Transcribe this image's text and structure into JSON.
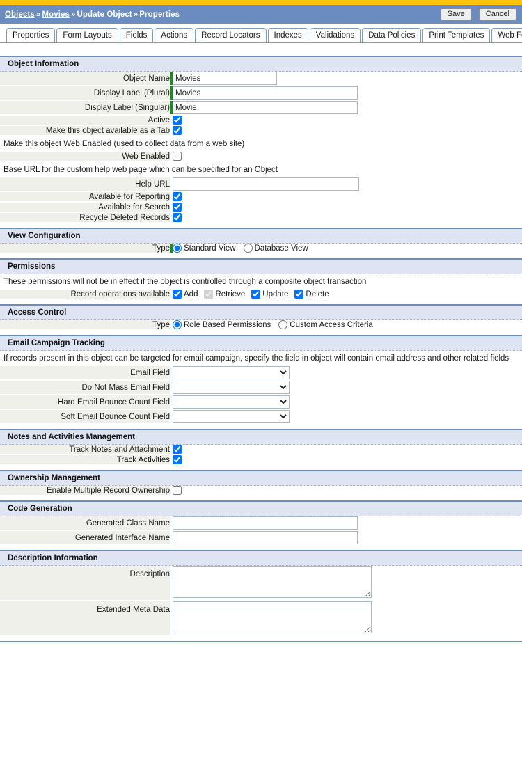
{
  "header": {
    "breadcrumb": [
      {
        "label": "Objects",
        "link": true
      },
      {
        "label": "Movies",
        "link": true
      },
      {
        "label": "Update Object",
        "link": false
      },
      {
        "label": "Properties",
        "link": false
      }
    ],
    "separator": "»",
    "save_label": "Save",
    "cancel_label": "Cancel",
    "accent_top_color": "#ffc20e",
    "bar_color": "#6b8cbe"
  },
  "tabs": [
    {
      "label": "Properties",
      "active": true
    },
    {
      "label": "Form Layouts",
      "active": false
    },
    {
      "label": "Fields",
      "active": false
    },
    {
      "label": "Actions",
      "active": false
    },
    {
      "label": "Record Locators",
      "active": false
    },
    {
      "label": "Indexes",
      "active": false
    },
    {
      "label": "Validations",
      "active": false
    },
    {
      "label": "Data Policies",
      "active": false
    },
    {
      "label": "Print Templates",
      "active": false
    },
    {
      "label": "Web Forms",
      "active": false
    }
  ],
  "sections": {
    "object_information": {
      "title": "Object Information",
      "object_name": {
        "label": "Object Name",
        "value": "Movies",
        "required": true
      },
      "display_label_plural": {
        "label": "Display Label (Plural)",
        "value": "Movies",
        "required": true
      },
      "display_label_singular": {
        "label": "Display Label (Singular)",
        "value": "Movie",
        "required": true
      },
      "active": {
        "label": "Active",
        "checked": true
      },
      "available_as_tab": {
        "label": "Make this object available as a Tab",
        "checked": true
      },
      "web_enabled_note": "Make this object Web Enabled (used to collect data from a web site)",
      "web_enabled": {
        "label": "Web Enabled",
        "checked": false
      },
      "help_url_note": "Base URL for the custom help web page which can be specified for an Object",
      "help_url": {
        "label": "Help URL",
        "value": ""
      },
      "available_for_reporting": {
        "label": "Available for Reporting",
        "checked": true
      },
      "available_for_search": {
        "label": "Available for Search",
        "checked": true
      },
      "recycle_deleted_records": {
        "label": "Recycle Deleted Records",
        "checked": true
      }
    },
    "view_configuration": {
      "title": "View Configuration",
      "type_label": "Type",
      "options": [
        {
          "label": "Standard View",
          "selected": true
        },
        {
          "label": "Database View",
          "selected": false
        }
      ]
    },
    "permissions": {
      "title": "Permissions",
      "note": "These permissions will not be in effect if the object is controlled through a composite object transaction",
      "record_ops_label": "Record operations available",
      "operations": [
        {
          "label": "Add",
          "checked": true,
          "disabled": false
        },
        {
          "label": "Retrieve",
          "checked": true,
          "disabled": true
        },
        {
          "label": "Update",
          "checked": true,
          "disabled": false
        },
        {
          "label": "Delete",
          "checked": true,
          "disabled": false
        }
      ]
    },
    "access_control": {
      "title": "Access Control",
      "type_label": "Type",
      "options": [
        {
          "label": "Role Based Permissions",
          "selected": true
        },
        {
          "label": "Custom Access Criteria",
          "selected": false
        }
      ]
    },
    "email_campaign_tracking": {
      "title": "Email Campaign Tracking",
      "note": "If records present in this object can be targeted for email campaign, specify the field in object will contain email address and other related fields",
      "email_field": {
        "label": "Email Field",
        "value": ""
      },
      "do_not_mass_email_field": {
        "label": "Do Not Mass Email Field",
        "value": ""
      },
      "hard_bounce_field": {
        "label": "Hard Email Bounce Count Field",
        "value": ""
      },
      "soft_bounce_field": {
        "label": "Soft Email Bounce Count Field",
        "value": ""
      }
    },
    "notes_activities": {
      "title": "Notes and Activities Management",
      "track_notes": {
        "label": "Track Notes and Attachment",
        "checked": true
      },
      "track_activities": {
        "label": "Track Activities",
        "checked": true
      }
    },
    "ownership": {
      "title": "Ownership Management",
      "multiple_owner": {
        "label": "Enable Multiple Record Ownership",
        "checked": false
      }
    },
    "code_generation": {
      "title": "Code Generation",
      "class_name": {
        "label": "Generated Class Name",
        "value": ""
      },
      "interface_name": {
        "label": "Generated Interface Name",
        "value": ""
      }
    },
    "description_information": {
      "title": "Description Information",
      "description": {
        "label": "Description",
        "value": ""
      },
      "extended_meta_data": {
        "label": "Extended Meta Data",
        "value": ""
      }
    }
  }
}
